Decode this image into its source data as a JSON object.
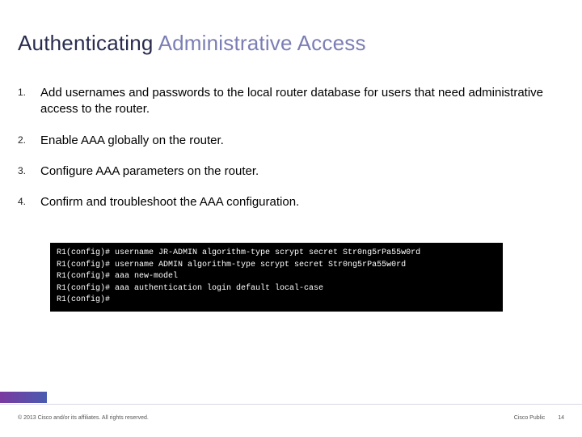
{
  "title": {
    "part1": "Authenticating ",
    "part2": "Administrative Access"
  },
  "steps": [
    {
      "num": "1.",
      "text": "Add usernames and passwords to the local router database for users that need administrative access to the router."
    },
    {
      "num": "2.",
      "text": "Enable AAA globally on the router."
    },
    {
      "num": "3.",
      "text": "Configure AAA parameters on the router."
    },
    {
      "num": "4.",
      "text": "Confirm and troubleshoot the AAA configuration."
    }
  ],
  "terminal": "R1(config)# username JR-ADMIN algorithm-type scrypt secret Str0ng5rPa55w0rd\nR1(config)# username ADMIN algorithm-type scrypt secret Str0ng5rPa55w0rd\nR1(config)# aaa new-model\nR1(config)# aaa authentication login default local-case\nR1(config)#",
  "footer": {
    "copyright": "© 2013 Cisco and/or its affiliates. All rights reserved.",
    "label": "Cisco Public",
    "page": "14"
  }
}
